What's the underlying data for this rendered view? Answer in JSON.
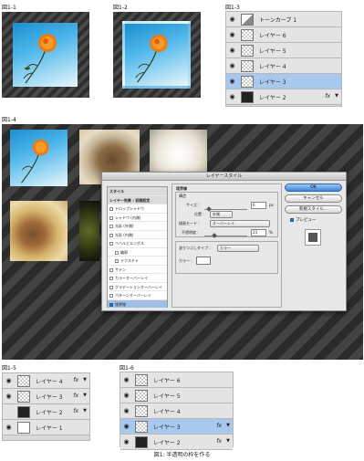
{
  "figure_labels": {
    "f1_1": "図1-1",
    "f1_2": "図1-2",
    "f1_3": "図1-3",
    "f1_4": "図1-4",
    "f1_5": "図1-5",
    "f1_6": "図1-6"
  },
  "caption": "図1: 半透明の枠を作る",
  "panel_1_3": {
    "layers": [
      {
        "name": "トーンカーブ 1",
        "thumb": "adjust",
        "visible": true,
        "selected": false,
        "fx": false
      },
      {
        "name": "レイヤー 6",
        "thumb": "transparent",
        "visible": true,
        "selected": false,
        "fx": false
      },
      {
        "name": "レイヤー 5",
        "thumb": "transparent",
        "visible": true,
        "selected": false,
        "fx": false
      },
      {
        "name": "レイヤー 4",
        "thumb": "transparent",
        "visible": true,
        "selected": false,
        "fx": false
      },
      {
        "name": "レイヤー 3",
        "thumb": "transparent",
        "visible": true,
        "selected": true,
        "fx": false
      },
      {
        "name": "レイヤー 2",
        "thumb": "dark",
        "visible": true,
        "selected": false,
        "fx": true
      }
    ]
  },
  "panel_1_5": {
    "layers": [
      {
        "name": "レイヤー 4",
        "thumb": "transparent",
        "visible": true,
        "selected": false,
        "fx": true
      },
      {
        "name": "レイヤー 3",
        "thumb": "transparent",
        "visible": true,
        "selected": false,
        "fx": true
      },
      {
        "name": "レイヤー 2",
        "thumb": "dark",
        "visible": false,
        "selected": false,
        "fx": true
      },
      {
        "name": "レイヤー 1",
        "thumb": "white",
        "visible": true,
        "selected": false,
        "fx": false
      }
    ]
  },
  "panel_1_6": {
    "layers": [
      {
        "name": "レイヤー 6",
        "thumb": "transparent",
        "visible": true,
        "selected": false,
        "fx": false
      },
      {
        "name": "レイヤー 5",
        "thumb": "transparent",
        "visible": true,
        "selected": false,
        "fx": false
      },
      {
        "name": "レイヤー 4",
        "thumb": "transparent",
        "visible": true,
        "selected": false,
        "fx": false
      },
      {
        "name": "レイヤー 3",
        "thumb": "transparent",
        "visible": true,
        "selected": true,
        "fx": true
      },
      {
        "name": "レイヤー 2",
        "thumb": "dark",
        "visible": true,
        "selected": false,
        "fx": true
      }
    ]
  },
  "fx_label": "fx",
  "dialog": {
    "title": "レイヤースタイル",
    "styles_header": "スタイル",
    "blend_header": "レイヤー効果 : 初期設定",
    "effects": [
      {
        "label": "ドロップシャドウ",
        "checked": false,
        "indent": false,
        "selected": false
      },
      {
        "label": "シャドウ (内側)",
        "checked": false,
        "indent": false,
        "selected": false
      },
      {
        "label": "光彩 (外側)",
        "checked": false,
        "indent": false,
        "selected": false
      },
      {
        "label": "光彩 (内側)",
        "checked": false,
        "indent": false,
        "selected": false
      },
      {
        "label": "ベベルとエンボス",
        "checked": false,
        "indent": false,
        "selected": false
      },
      {
        "label": "輪郭",
        "checked": false,
        "indent": true,
        "selected": false
      },
      {
        "label": "テクスチャ",
        "checked": false,
        "indent": true,
        "selected": false
      },
      {
        "label": "サテン",
        "checked": false,
        "indent": false,
        "selected": false
      },
      {
        "label": "カラーオーバーレイ",
        "checked": false,
        "indent": false,
        "selected": false
      },
      {
        "label": "グラデーションオーバーレイ",
        "checked": false,
        "indent": false,
        "selected": false
      },
      {
        "label": "パターンオーバーレイ",
        "checked": false,
        "indent": false,
        "selected": false
      },
      {
        "label": "境界線",
        "checked": true,
        "indent": false,
        "selected": true
      }
    ],
    "stroke_title": "境界線",
    "structure_title": "構造",
    "size_label": "サイズ :",
    "size_value": "6",
    "size_unit": "px",
    "size_level": 0.1,
    "position_label": "位置 :",
    "position_value": "外側",
    "blend_mode_label": "描画モード :",
    "blend_mode_value": "オーバーレイ",
    "opacity_label": "不透明度 :",
    "opacity_value": "23",
    "opacity_unit": "%",
    "opacity_level": 0.23,
    "fill_type_label": "塗りつぶしタイプ :",
    "fill_type_value": "カラー",
    "color_label": "カラー :",
    "color_value": "#ffffff",
    "buttons": {
      "ok": "OK",
      "cancel": "キャンセル",
      "new_style": "新規スタイル...",
      "preview": "プレビュー"
    },
    "preview_checked": true
  },
  "colors": {
    "selection": "#a9c8ee",
    "ok_button": "#3f86d8"
  }
}
